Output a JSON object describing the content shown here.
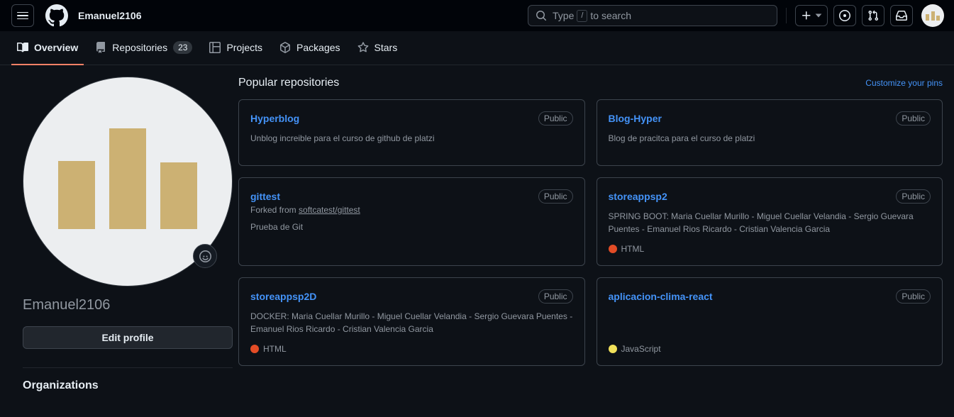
{
  "header": {
    "menu_icon": "hamburger-icon",
    "logo_icon": "github-logo-icon",
    "username": "Emanuel2106",
    "search": {
      "placeholder_prefix": "Type",
      "shortcut_key": "/",
      "placeholder_suffix": "to search",
      "icon": "search-icon"
    },
    "actions": [
      {
        "name": "create-new-button",
        "icon": "plus-icon",
        "has_chevron": true
      },
      {
        "name": "issues-button",
        "icon": "issue-opened-icon",
        "has_chevron": false
      },
      {
        "name": "pull-requests-button",
        "icon": "git-pull-request-icon",
        "has_chevron": false
      },
      {
        "name": "notifications-button",
        "icon": "inbox-icon",
        "has_chevron": false
      }
    ],
    "avatar_alt": "user-avatar"
  },
  "nav": {
    "tabs": [
      {
        "label": "Overview",
        "icon": "book-icon",
        "count": null,
        "active": true
      },
      {
        "label": "Repositories",
        "icon": "repo-icon",
        "count": "23",
        "active": false
      },
      {
        "label": "Projects",
        "icon": "table-icon",
        "count": null,
        "active": false
      },
      {
        "label": "Packages",
        "icon": "package-icon",
        "count": null,
        "active": false
      },
      {
        "label": "Stars",
        "icon": "star-icon",
        "count": null,
        "active": false
      }
    ]
  },
  "sidebar": {
    "avatar_alt": "profile-avatar",
    "status_emoji_icon": "smiley-icon",
    "username": "Emanuel2106",
    "edit_profile_label": "Edit profile",
    "organizations_heading": "Organizations"
  },
  "main": {
    "title": "Popular repositories",
    "customize_link": "Customize your pins",
    "repositories": [
      {
        "name": "Hyperblog",
        "visibility": "Public",
        "forked_from_prefix": null,
        "forked_from": null,
        "description": "Unblog increible para el curso de github de platzi",
        "language": null,
        "language_color": null
      },
      {
        "name": "Blog-Hyper",
        "visibility": "Public",
        "forked_from_prefix": null,
        "forked_from": null,
        "description": "Blog de pracitca para el curso de platzi",
        "language": null,
        "language_color": null
      },
      {
        "name": "gittest",
        "visibility": "Public",
        "forked_from_prefix": "Forked from",
        "forked_from": "softcatest/gittest",
        "description": "Prueba de Git",
        "language": null,
        "language_color": null
      },
      {
        "name": "storeappsp2",
        "visibility": "Public",
        "forked_from_prefix": null,
        "forked_from": null,
        "description": "SPRING BOOT: Maria Cuellar Murillo - Miguel Cuellar Velandia - Sergio Guevara Puentes - Emanuel Rios Ricardo - Cristian Valencia Garcia",
        "language": "HTML",
        "language_color": "#e34c26"
      },
      {
        "name": "storeappsp2D",
        "visibility": "Public",
        "forked_from_prefix": null,
        "forked_from": null,
        "description": "DOCKER: Maria Cuellar Murillo - Miguel Cuellar Velandia - Sergio Guevara Puentes - Emanuel Rios Ricardo - Cristian Valencia Garcia",
        "language": "HTML",
        "language_color": "#e34c26"
      },
      {
        "name": "aplicacion-clima-react",
        "visibility": "Public",
        "forked_from_prefix": null,
        "forked_from": null,
        "description": null,
        "language": "JavaScript",
        "language_color": "#f1e05a"
      }
    ]
  },
  "colors": {
    "page_bg": "#0d1117",
    "header_bg": "#010409",
    "border": "#3d444d",
    "link": "#4493f8",
    "muted_text": "#9198a1",
    "active_tab_underline": "#f78166",
    "avatar_bar": "#ccb173"
  }
}
